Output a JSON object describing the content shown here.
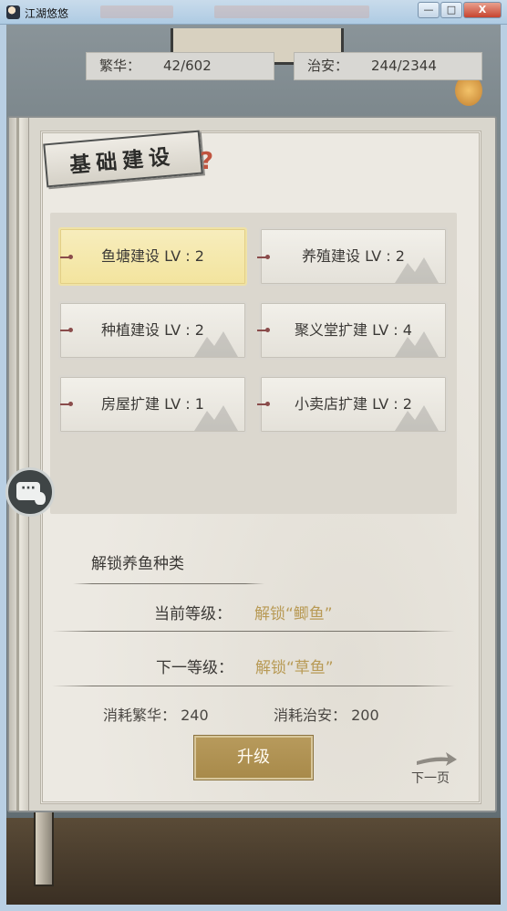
{
  "window": {
    "title": "江湖悠悠",
    "minimize": "—",
    "maximize": "□",
    "close": "X"
  },
  "stats": {
    "prosperity_label": "繁华：",
    "prosperity_value": "42/602",
    "security_label": "治安：",
    "security_value": "244/2344"
  },
  "panel": {
    "title": "基础建设",
    "help": "?"
  },
  "buildings": [
    {
      "label": "鱼塘建设 LV : 2",
      "selected": true
    },
    {
      "label": "养殖建设 LV : 2",
      "selected": false
    },
    {
      "label": "种植建设 LV : 2",
      "selected": false
    },
    {
      "label": "聚义堂扩建 LV : 4",
      "selected": false
    },
    {
      "label": "房屋扩建 LV : 1",
      "selected": false
    },
    {
      "label": "小卖店扩建 LV : 2",
      "selected": false
    }
  ],
  "detail": {
    "description": "解锁养鱼种类",
    "current_label": "当前等级：",
    "current_value": "解锁“鲫鱼”",
    "next_label": "下一等级：",
    "next_value": "解锁“草鱼”",
    "cost_prosperity": "消耗繁华：  240",
    "cost_security": "消耗治安：  200"
  },
  "actions": {
    "upgrade": "升级",
    "next_page": "下一页"
  },
  "colors": {
    "selected_card": "#f5e8ae",
    "value_gold": "#b89a55",
    "button_gold": "#b09352"
  }
}
